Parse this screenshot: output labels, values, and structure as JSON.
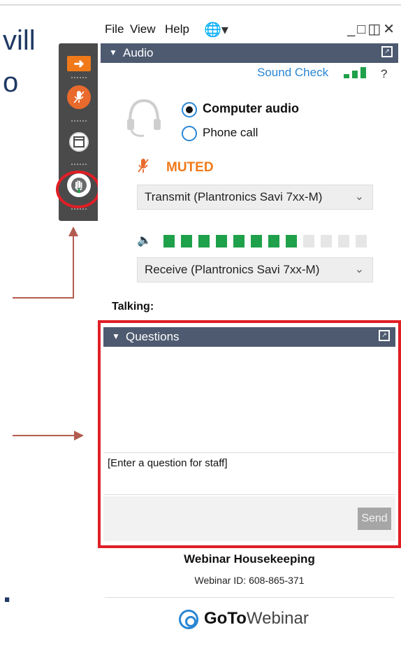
{
  "background": {
    "fragment_1": "vill",
    "fragment_2": "o",
    "fragment_3": "."
  },
  "menu": {
    "file": "File",
    "view": "View",
    "help": "Help",
    "globe_icon": "globe-icon",
    "window_controls": "_□◫✕"
  },
  "grab_tab": {
    "icons": [
      "arrow-right-icon",
      "microphone-muted-icon",
      "screen-icon",
      "raise-hand-icon"
    ]
  },
  "audio": {
    "title": "Audio",
    "sound_check": "Sound Check",
    "help": "?",
    "options": [
      {
        "label": "Computer audio",
        "selected": true
      },
      {
        "label": "Phone call",
        "selected": false
      }
    ],
    "status": "MUTED",
    "transmit_device": "Transmit (Plantronics Savi 7xx-M)",
    "receive_device": "Receive (Plantronics Savi 7xx-M)",
    "input_level_segments_active": 8,
    "input_level_segments_total": 12,
    "talking_label": "Talking:",
    "colors": {
      "header": "#4d5a70",
      "link": "#2a86d3",
      "muted": "#f07a1a",
      "level": "#1fa04a"
    }
  },
  "questions": {
    "title": "Questions",
    "input_placeholder": "[Enter a question for staff]",
    "send_label": "Send",
    "highlight_color": "#e01e26"
  },
  "footer": {
    "title": "Webinar Housekeeping",
    "webinar_id": "Webinar ID: 608-865-371",
    "brand_bold": "GoTo",
    "brand_regular": "Webinar"
  }
}
